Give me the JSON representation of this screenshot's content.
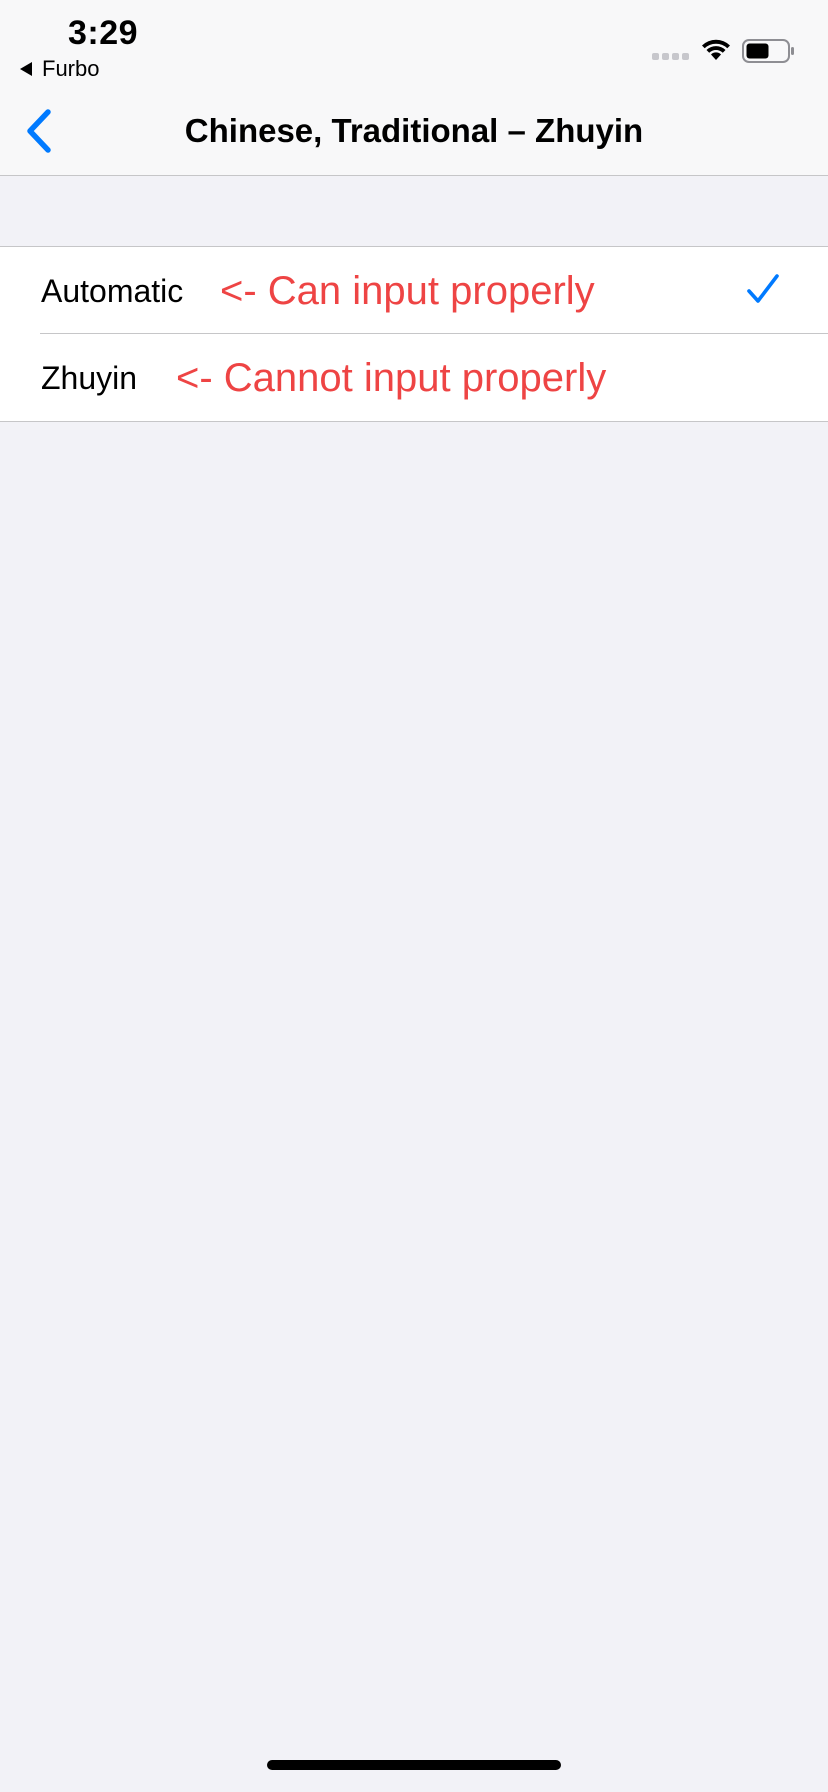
{
  "status_bar": {
    "time": "3:29",
    "back_app": "Furbo",
    "icons": [
      "signal-icon",
      "wifi-icon",
      "battery-icon"
    ]
  },
  "nav": {
    "back_icon": "chevron-left-icon",
    "title": "Chinese, Traditional – Zhuyin"
  },
  "options": [
    {
      "label": "Automatic",
      "annotation": "<- Can input properly",
      "selected": true
    },
    {
      "label": "Zhuyin",
      "annotation": "<- Cannot input properly",
      "selected": false
    }
  ],
  "colors": {
    "accent": "#007aff",
    "annotation": "#ee4444",
    "background": "#f2f2f7"
  }
}
